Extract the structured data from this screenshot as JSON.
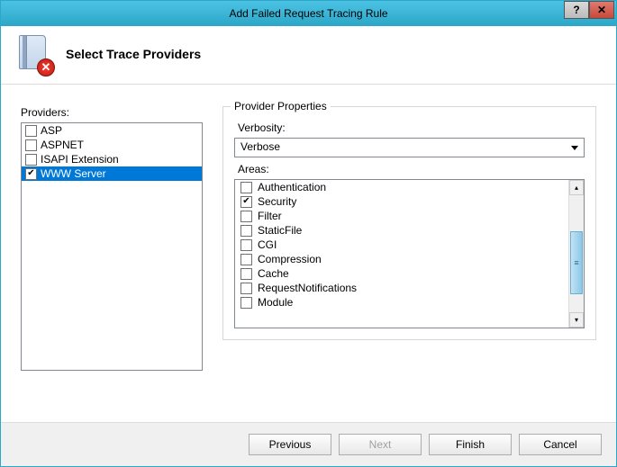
{
  "window": {
    "title": "Add Failed Request Tracing Rule"
  },
  "header": {
    "title": "Select Trace Providers"
  },
  "providers": {
    "label": "Providers:",
    "items": [
      {
        "label": "ASP",
        "checked": false,
        "selected": false
      },
      {
        "label": "ASPNET",
        "checked": false,
        "selected": false
      },
      {
        "label": "ISAPI Extension",
        "checked": false,
        "selected": false
      },
      {
        "label": "WWW Server",
        "checked": true,
        "selected": true
      }
    ]
  },
  "properties": {
    "group_title": "Provider Properties",
    "verbosity_label": "Verbosity:",
    "verbosity_value": "Verbose",
    "areas_label": "Areas:",
    "areas": [
      {
        "label": "Authentication",
        "checked": false
      },
      {
        "label": "Security",
        "checked": true
      },
      {
        "label": "Filter",
        "checked": false
      },
      {
        "label": "StaticFile",
        "checked": false
      },
      {
        "label": "CGI",
        "checked": false
      },
      {
        "label": "Compression",
        "checked": false
      },
      {
        "label": "Cache",
        "checked": false
      },
      {
        "label": "RequestNotifications",
        "checked": false
      },
      {
        "label": "Module",
        "checked": false
      }
    ]
  },
  "buttons": {
    "previous": "Previous",
    "next": "Next",
    "finish": "Finish",
    "cancel": "Cancel"
  }
}
